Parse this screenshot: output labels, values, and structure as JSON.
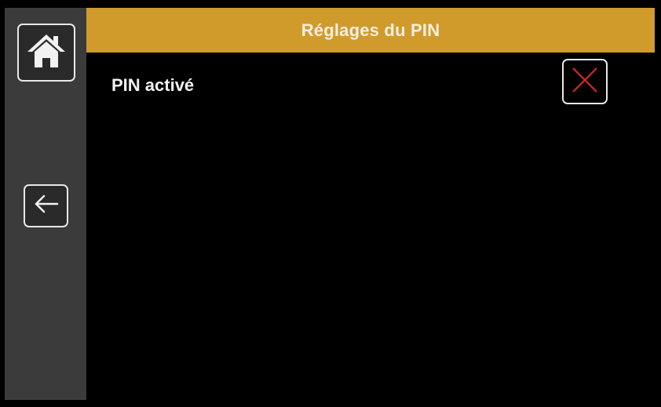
{
  "header": {
    "title": "Réglages du PIN"
  },
  "sidebar": {
    "home_icon": "home-icon",
    "back_icon": "arrow-left-icon"
  },
  "settings": {
    "pin_enabled": {
      "label": "PIN activé",
      "state": "off",
      "state_icon": "cross-icon"
    }
  },
  "colors": {
    "header_bg": "#d19b2b",
    "sidebar_bg": "#3b3b3b",
    "screen_bg": "#000000",
    "cross_color": "#e0262a",
    "text": "#f2f2f2"
  }
}
